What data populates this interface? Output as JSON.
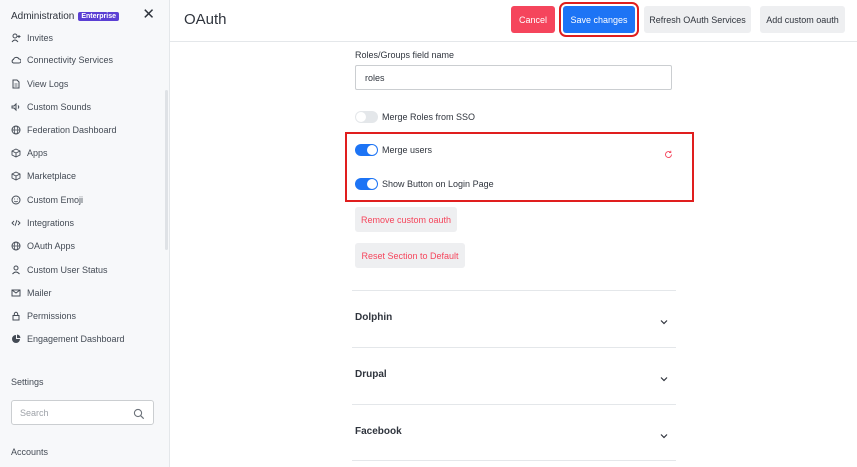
{
  "sidebar": {
    "title": "Administration",
    "badge": "Enterprise",
    "close_icon": "close-icon",
    "items": [
      {
        "label": "Invites",
        "icon": "user-plus-icon"
      },
      {
        "label": "Connectivity Services",
        "icon": "cloud-icon"
      },
      {
        "label": "View Logs",
        "icon": "file-icon"
      },
      {
        "label": "Custom Sounds",
        "icon": "speaker-icon"
      },
      {
        "label": "Federation Dashboard",
        "icon": "globe-icon"
      },
      {
        "label": "Apps",
        "icon": "cube-icon"
      },
      {
        "label": "Marketplace",
        "icon": "cube-icon"
      },
      {
        "label": "Custom Emoji",
        "icon": "emoji-icon"
      },
      {
        "label": "Integrations",
        "icon": "code-icon"
      },
      {
        "label": "OAuth Apps",
        "icon": "globe-icon"
      },
      {
        "label": "Custom User Status",
        "icon": "user-icon"
      },
      {
        "label": "Mailer",
        "icon": "mail-icon"
      },
      {
        "label": "Permissions",
        "icon": "lock-icon"
      },
      {
        "label": "Engagement Dashboard",
        "icon": "pie-chart-icon"
      }
    ],
    "settings_label": "Settings",
    "search_placeholder": "Search",
    "accounts_label": "Accounts"
  },
  "header": {
    "title": "OAuth",
    "cancel_label": "Cancel",
    "save_label": "Save changes",
    "refresh_label": "Refresh OAuth Services",
    "add_label": "Add custom oauth"
  },
  "main": {
    "roles_field_label": "Roles/Groups field name",
    "roles_field_value": "roles",
    "toggles": [
      {
        "label": "Merge Roles from SSO",
        "on": false
      },
      {
        "label": "Merge users",
        "on": true
      },
      {
        "label": "Show Button on Login Page",
        "on": true
      }
    ],
    "remove_label": "Remove custom oauth",
    "reset_label": "Reset Section to Default",
    "sections": [
      "Dolphin",
      "Drupal",
      "Facebook"
    ]
  },
  "colors": {
    "accent": "#1d74f5",
    "danger": "#f5455c",
    "highlight": "#e01e1e"
  }
}
